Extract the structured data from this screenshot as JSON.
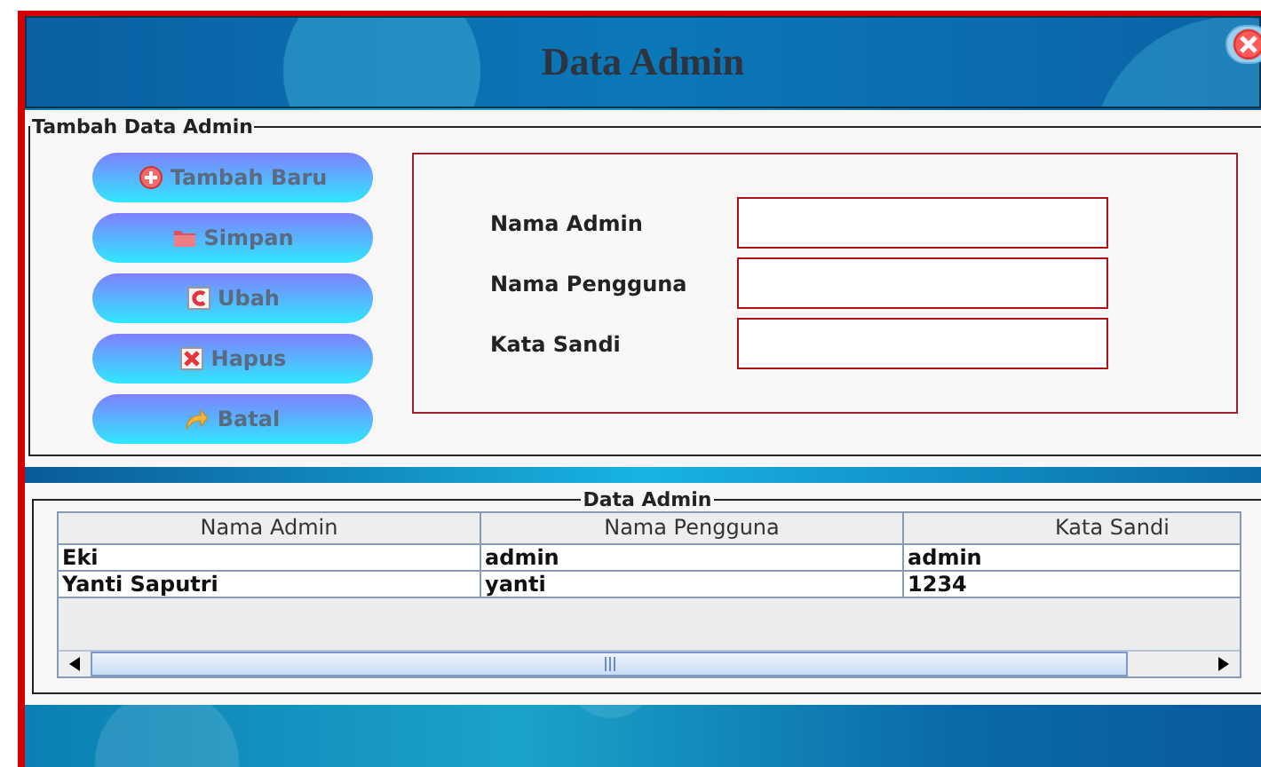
{
  "window": {
    "title": "Data Admin"
  },
  "form_panel": {
    "title": "Tambah Data Admin",
    "buttons": [
      {
        "label": "Tambah Baru",
        "kind": "add"
      },
      {
        "label": "Simpan",
        "kind": "save"
      },
      {
        "label": "Ubah",
        "kind": "edit"
      },
      {
        "label": "Hapus",
        "kind": "delete"
      },
      {
        "label": "Batal",
        "kind": "cancel"
      }
    ],
    "fields": [
      {
        "label": "Nama Admin"
      },
      {
        "label": "Nama Pengguna"
      },
      {
        "label": "Kata Sandi"
      }
    ]
  },
  "table_panel": {
    "title": "Data Admin",
    "columns": [
      "Nama Admin",
      "Nama Pengguna",
      "Kata Sandi"
    ],
    "rows": [
      [
        "Eki",
        "admin",
        "admin"
      ],
      [
        "Yanti Saputri",
        "yanti",
        "1234"
      ]
    ]
  }
}
